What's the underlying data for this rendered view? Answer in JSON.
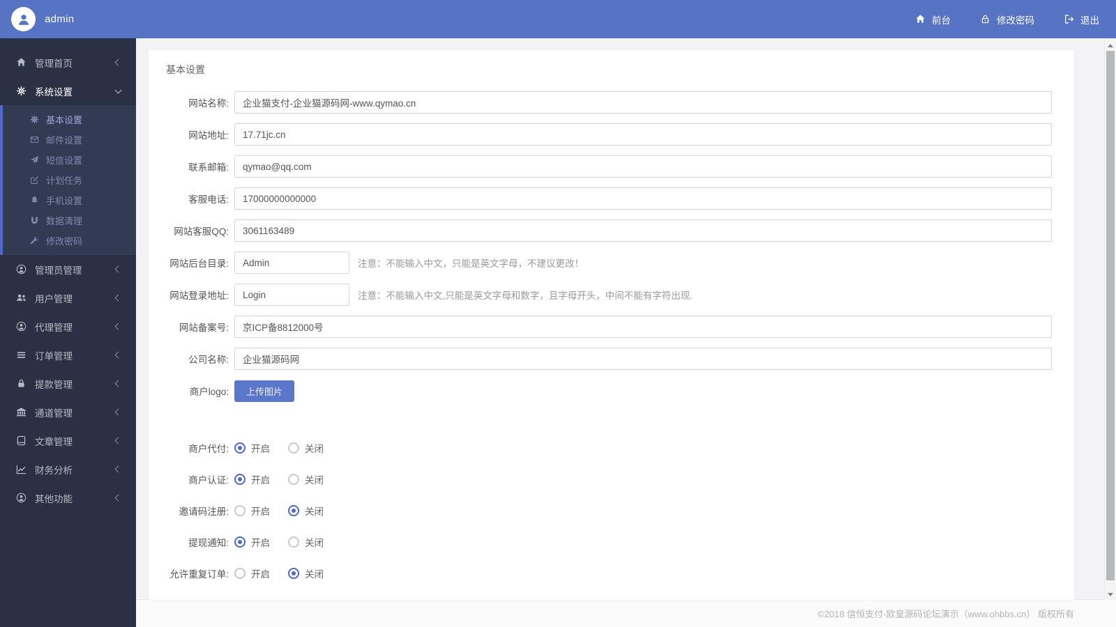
{
  "colors": {
    "topbar_bg": "#5673c4",
    "sidebar_bg": "#2b3144",
    "submenu_bg": "#333a54",
    "submenu_stripe": "#4c6bd2",
    "sidebar_text": "#b3bac3",
    "submenu_text": "#7e89ae",
    "content_bg": "#f3f3f5",
    "card_bg": "#ffffff",
    "input_border": "#d5d5d7",
    "label_color": "#555555",
    "note_color": "#9a9a9e",
    "footer_text": "#b4b4b8",
    "radio_on": "#4a6ac6",
    "button_bg": "#5b77ca"
  },
  "topbar": {
    "username": "admin",
    "avatar_icon": "person-icon",
    "links": [
      {
        "label": "前台",
        "icon": "home-icon"
      },
      {
        "label": "修改密码",
        "icon": "unlock-icon"
      },
      {
        "label": "退出",
        "icon": "sign-out-icon"
      }
    ]
  },
  "sidebar": {
    "items": [
      {
        "label": "管理首页",
        "icon": "home-icon",
        "state": "collapsed"
      },
      {
        "label": "系统设置",
        "icon": "cog-icon",
        "state": "expanded",
        "active": true,
        "children": [
          {
            "label": "基本设置",
            "icon": "cog-icon",
            "active": true
          },
          {
            "label": "邮件设置",
            "icon": "envelope-icon"
          },
          {
            "label": "短信设置",
            "icon": "paper-plane-icon"
          },
          {
            "label": "计划任务",
            "icon": "edit-icon"
          },
          {
            "label": "手机设置",
            "icon": "bell-icon"
          },
          {
            "label": "数据清理",
            "icon": "magnet-icon"
          },
          {
            "label": "修改密码",
            "icon": "wrench-icon"
          }
        ]
      },
      {
        "label": "管理员管理",
        "icon": "user-icon",
        "state": "collapsed"
      },
      {
        "label": "用户管理",
        "icon": "users-icon",
        "state": "collapsed"
      },
      {
        "label": "代理管理",
        "icon": "user-icon",
        "state": "collapsed"
      },
      {
        "label": "订单管理",
        "icon": "list-icon",
        "state": "collapsed"
      },
      {
        "label": "提款管理",
        "icon": "lock-icon",
        "state": "collapsed"
      },
      {
        "label": "通道管理",
        "icon": "bank-icon",
        "state": "collapsed"
      },
      {
        "label": "文章管理",
        "icon": "book-icon",
        "state": "collapsed"
      },
      {
        "label": "财务分析",
        "icon": "chart-line-icon",
        "state": "collapsed"
      },
      {
        "label": "其他功能",
        "icon": "user-icon",
        "state": "collapsed"
      }
    ]
  },
  "main": {
    "title": "基本设置",
    "fields": [
      {
        "label": "网站名称:",
        "type": "text",
        "size": "wide",
        "value": "企业猫支付-企业猫源码网-www.qymao.cn"
      },
      {
        "label": "网站地址:",
        "type": "text",
        "size": "wide",
        "value": "17.71jc.cn"
      },
      {
        "label": "联系邮箱:",
        "type": "text",
        "size": "wide",
        "value": "qymao@qq.com"
      },
      {
        "label": "客服电话:",
        "type": "text",
        "size": "wide",
        "value": "17000000000000"
      },
      {
        "label": "网站客服QQ:",
        "type": "text",
        "size": "wide",
        "value": "3061163489"
      },
      {
        "label": "网站后台目录:",
        "type": "text",
        "size": "narrow",
        "value": "Admin",
        "note": "注意：不能输入中文，只能是英文字母，不建议更改！"
      },
      {
        "label": "网站登录地址:",
        "type": "text",
        "size": "narrow",
        "value": "Login",
        "note": "注意：不能输入中文,只能是英文字母和数字，且字母开头，中间不能有字符出现."
      },
      {
        "label": "网站备案号:",
        "type": "text",
        "size": "wide",
        "value": "京ICP备8812000号"
      },
      {
        "label": "公司名称:",
        "type": "text",
        "size": "wide",
        "value": "企业猫源码网"
      },
      {
        "label": "商户logo:",
        "type": "upload",
        "button_label": "上传图片"
      }
    ],
    "toggles": [
      {
        "label": "商户代付:",
        "options": [
          "开启",
          "关闭"
        ],
        "selected": 0
      },
      {
        "label": "商户认证:",
        "options": [
          "开启",
          "关闭"
        ],
        "selected": 0
      },
      {
        "label": "邀请码注册:",
        "options": [
          "开启",
          "关闭"
        ],
        "selected": 1
      },
      {
        "label": "提现通知:",
        "options": [
          "开启",
          "关闭"
        ],
        "selected": 0
      },
      {
        "label": "允许重复订单:",
        "options": [
          "开启",
          "关闭"
        ],
        "selected": 1
      }
    ]
  },
  "footer": {
    "copyright": "©2018 信恒支付-欧皇源码论坛演示（www.ohbbs.cn） 版权所有"
  }
}
